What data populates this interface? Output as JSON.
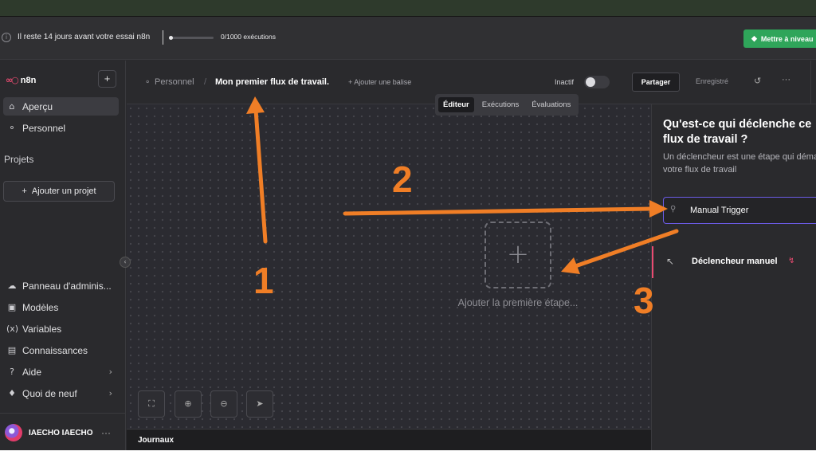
{
  "trial": {
    "message": "Il reste 14 jours avant votre essai n8n",
    "executions": "0/1000",
    "executions_label": "exécutions",
    "executions_progress": 0.0,
    "upgrade_label": "Mettre à niveau",
    "upgrade_color": "#2fa55a"
  },
  "sidebar": {
    "logo": "n8n",
    "items": [
      {
        "label": "Aperçu",
        "icon": "home-icon",
        "active": true
      },
      {
        "label": "Personnel",
        "icon": "user-icon",
        "active": false
      }
    ],
    "projects_label": "Projets",
    "add_project_label": "Ajouter un projet",
    "bottom_items": [
      {
        "label": "Panneau d'adminis...",
        "icon": "cloud-icon"
      },
      {
        "label": "Modèles",
        "icon": "templates-icon"
      },
      {
        "label": "Variables",
        "icon": "variables-icon"
      },
      {
        "label": "Connaissances",
        "icon": "chart-icon"
      },
      {
        "label": "Aide",
        "icon": "help-icon"
      },
      {
        "label": "Quoi de neuf",
        "icon": "bell-icon"
      }
    ],
    "user_name": "IAECHO IAECHO"
  },
  "header": {
    "breadcrumb_owner": "Personnel",
    "breadcrumb_separator": "/",
    "workflow_title": "Mon premier flux de travail.",
    "add_tag": "+ Ajouter une balise",
    "status_label": "Inactif",
    "active": false,
    "share_label": "Partager",
    "saved_label": "Enregistré"
  },
  "tabs": [
    {
      "label": "Éditeur",
      "active": true
    },
    {
      "label": "Exécutions",
      "active": false
    },
    {
      "label": "Évaluations",
      "active": false
    }
  ],
  "canvas": {
    "add_first_step": "Ajouter la première étape..."
  },
  "logs_label": "Journaux",
  "panel": {
    "title": "Qu'est-ce qui déclenche ce flux de travail ?",
    "description": "Un déclencheur est une étape qui démarre votre flux de travail",
    "search_value": "Manual Trigger",
    "result_label": "Déclencheur manuel",
    "accent_color": "#ea4b71"
  },
  "annotations": {
    "labels": [
      "1",
      "2",
      "3"
    ],
    "color": "#f07e26"
  }
}
